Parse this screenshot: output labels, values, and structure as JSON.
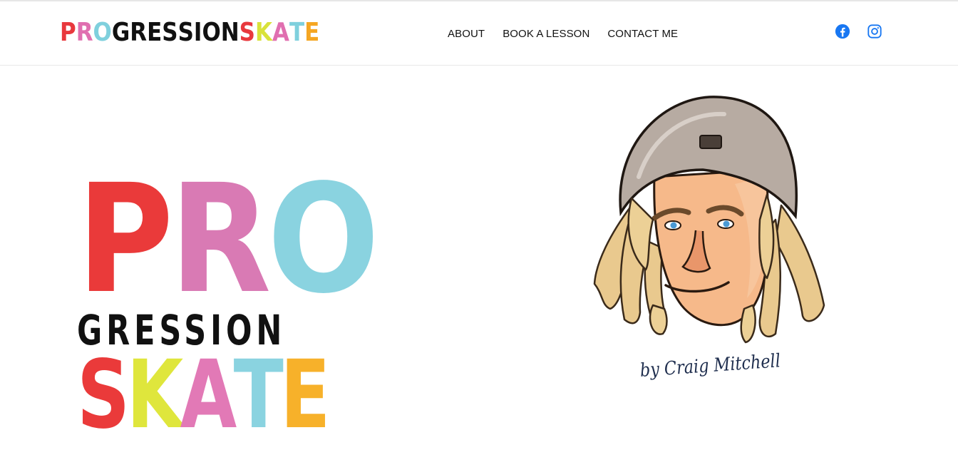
{
  "header": {
    "logo": {
      "letters": [
        {
          "ch": "P",
          "color": "#e8383d"
        },
        {
          "ch": "R",
          "color": "#e06fb0"
        },
        {
          "ch": "O",
          "color": "#7fd0dd"
        },
        {
          "ch": "G",
          "color": "#111111"
        },
        {
          "ch": "R",
          "color": "#111111"
        },
        {
          "ch": "E",
          "color": "#111111"
        },
        {
          "ch": "S",
          "color": "#111111"
        },
        {
          "ch": "S",
          "color": "#111111"
        },
        {
          "ch": "I",
          "color": "#111111"
        },
        {
          "ch": "O",
          "color": "#111111"
        },
        {
          "ch": "N",
          "color": "#111111"
        },
        {
          "ch": "S",
          "color": "#e8383d"
        },
        {
          "ch": "K",
          "color": "#d9e23a"
        },
        {
          "ch": "A",
          "color": "#e06fb0"
        },
        {
          "ch": "T",
          "color": "#7fd0dd"
        },
        {
          "ch": "E",
          "color": "#f5a623"
        }
      ]
    },
    "nav": [
      {
        "label": "ABOUT"
      },
      {
        "label": "BOOK A LESSON"
      },
      {
        "label": "CONTACT ME"
      }
    ],
    "social": [
      {
        "icon": "facebook-icon",
        "color": "#1877f2"
      },
      {
        "icon": "instagram-icon",
        "color": "#1877f2"
      }
    ]
  },
  "hero": {
    "big_logo": {
      "pro": [
        {
          "ch": "P",
          "color": "#ea3a3a"
        },
        {
          "ch": "R",
          "color": "#d97ab4"
        },
        {
          "ch": "O",
          "color": "#8ad3e0"
        }
      ],
      "gression": "GRESSION",
      "skate": [
        {
          "ch": "S",
          "color": "#ea3a3a"
        },
        {
          "ch": "K",
          "color": "#dfe63c"
        },
        {
          "ch": "A",
          "color": "#e279b6"
        },
        {
          "ch": "T",
          "color": "#8ad3e0"
        },
        {
          "ch": "E",
          "color": "#f7b12a"
        }
      ]
    },
    "byline": "by Craig Mitchell"
  }
}
